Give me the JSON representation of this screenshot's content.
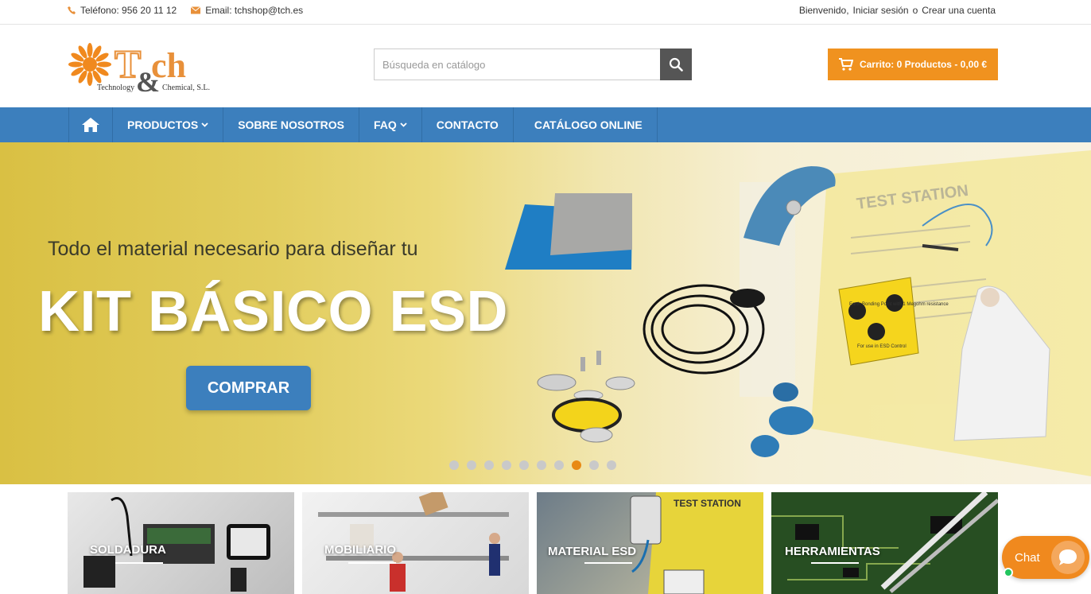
{
  "topbar": {
    "phone": "Teléfono: 956 20 11 12",
    "email": "Email: tchshop@tch.es",
    "welcome": "Bienvenido,",
    "login": "Iniciar sesión",
    "or": "o",
    "register": "Crear una cuenta"
  },
  "logo": {
    "name": "T&ch",
    "line1": "Technology",
    "line2": "Chemical, S.L."
  },
  "search": {
    "placeholder": "Búsqueda en catálogo"
  },
  "cart": {
    "label": "Carrito: 0 Productos - 0,00 €"
  },
  "nav": {
    "items": [
      "PRODUCTOS",
      "SOBRE NOSOTROS",
      "FAQ",
      "CONTACTO",
      "CATÁLOGO ONLINE"
    ]
  },
  "hero": {
    "subtitle": "Todo el material necesario para diseñar tu",
    "title": "KIT BÁSICO ESD",
    "button": "COMPRAR",
    "slide_count": 10,
    "active_slide": 8,
    "art_text": {
      "station": "TEST STATION",
      "point": "Earth Bonding Point with 1 Megohm resistance",
      "control": "For use in ESD Control"
    }
  },
  "categories": [
    "SOLDADURA",
    "MOBILIARIO",
    "MATERIAL ESD",
    "HERRAMIENTAS"
  ],
  "chat": {
    "label": "Chat"
  },
  "colors": {
    "accent_orange": "#f0921f",
    "nav_blue": "#3c7fbd"
  }
}
